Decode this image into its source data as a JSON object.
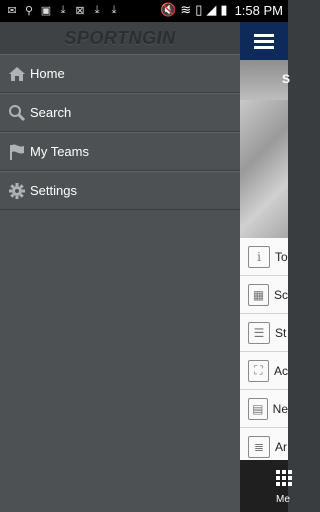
{
  "status_bar": {
    "time": "1:58 PM",
    "icons": [
      "notification-icon",
      "usb-icon",
      "image-icon",
      "download-icon",
      "dictionary-icon",
      "download-icon",
      "download-icon",
      "mute-icon",
      "wifi-icon",
      "sim-icon",
      "signal-icon",
      "battery-icon"
    ]
  },
  "drawer": {
    "logo": "SPORTNGIN",
    "items": [
      {
        "label": "Home",
        "icon": "home-icon"
      },
      {
        "label": "Search",
        "icon": "search-icon"
      },
      {
        "label": "My Teams",
        "icon": "flag-icon"
      },
      {
        "label": "Settings",
        "icon": "gear-icon"
      }
    ]
  },
  "background_app": {
    "header_letter": "S",
    "rows": [
      {
        "label": "To",
        "icon": "info-icon"
      },
      {
        "label": "Sc",
        "icon": "calendar-icon"
      },
      {
        "label": "St",
        "icon": "standings-icon"
      },
      {
        "label": "Ac",
        "icon": "map-icon"
      },
      {
        "label": "Ne",
        "icon": "news-icon"
      },
      {
        "label": "Ar",
        "icon": "articles-icon"
      }
    ],
    "bottom_label": "Me"
  },
  "colors": {
    "drawer_bg": "#4d5154",
    "app_header": "#0d2a5a"
  }
}
